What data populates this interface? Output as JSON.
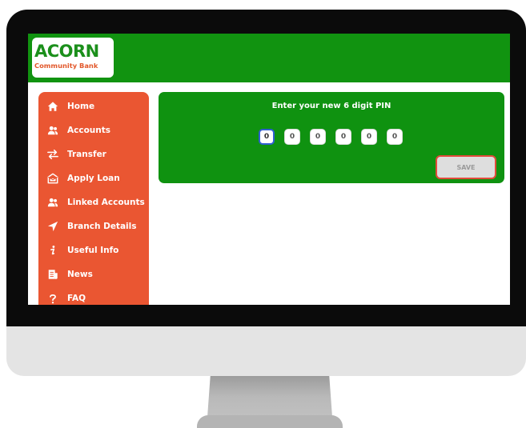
{
  "logo": {
    "name": "ACORN",
    "subtitle": "Community Bank"
  },
  "colors": {
    "header_green": "#119310",
    "panel_green": "#0f9210",
    "sidebar_orange": "#ea5632",
    "logo_green": "#1b8f1b",
    "logo_orange": "#e2582b",
    "save_border": "#e24a3a"
  },
  "sidebar": {
    "items": [
      {
        "label": "Home",
        "icon": "home-icon"
      },
      {
        "label": "Accounts",
        "icon": "users-icon"
      },
      {
        "label": "Transfer",
        "icon": "transfer-icon"
      },
      {
        "label": "Apply Loan",
        "icon": "loan-icon"
      },
      {
        "label": "Linked Accounts",
        "icon": "users-icon"
      },
      {
        "label": "Branch Details",
        "icon": "location-arrow-icon"
      },
      {
        "label": "Useful Info",
        "icon": "info-icon"
      },
      {
        "label": "News",
        "icon": "news-icon"
      },
      {
        "label": "FAQ",
        "icon": "question-icon"
      }
    ]
  },
  "pin": {
    "title": "Enter your new 6 digit PIN",
    "digits": [
      "0",
      "0",
      "0",
      "0",
      "0",
      "0"
    ],
    "active_index": 0
  },
  "save_label": "SAVE"
}
